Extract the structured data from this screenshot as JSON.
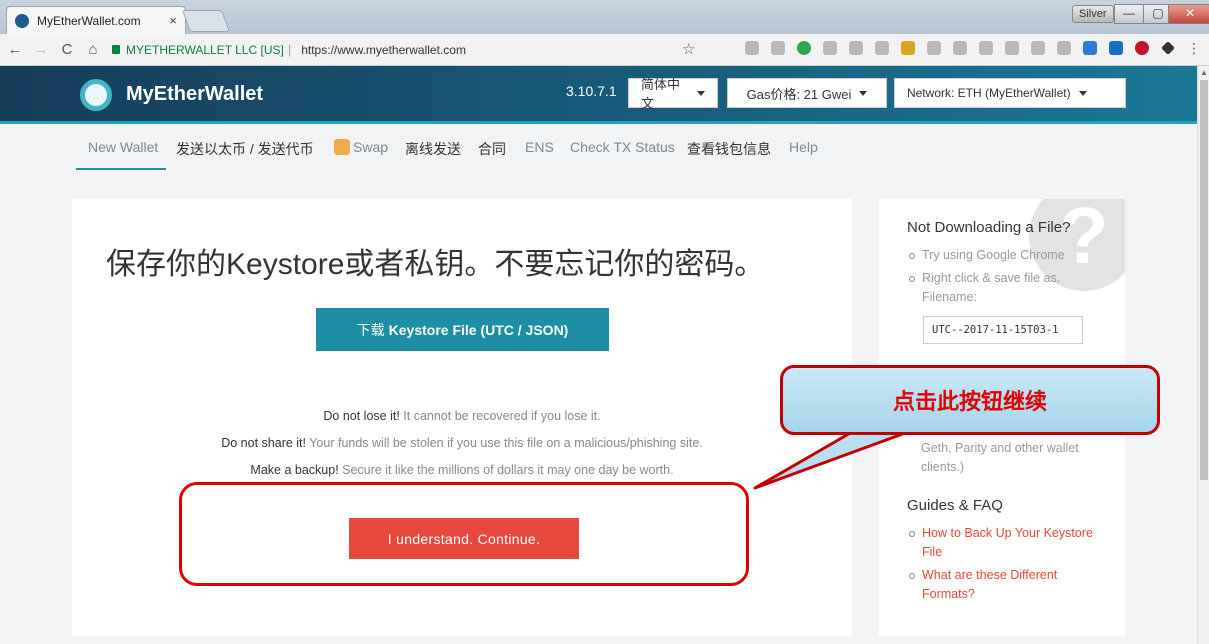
{
  "browser": {
    "tab_title": "MyEtherWallet.com",
    "tab_close": "×",
    "profile": "Silver",
    "win_min": "—",
    "win_max": "▢",
    "win_close": "✕",
    "back": "←",
    "forward": "→",
    "reload": "C",
    "home": "⌂",
    "secure_label": "MYETHERWALLET LLC [US]",
    "url": "https://www.myetherwallet.com",
    "star": "☆"
  },
  "header": {
    "brand": "MyEtherWallet",
    "version": "3.10.7.1",
    "language": "简体中文",
    "gas": "Gas价格: 21 Gwei",
    "network": "Network: ETH (MyEtherWallet)"
  },
  "nav": {
    "new_wallet": "New Wallet",
    "send": "发送以太币 / 发送代币",
    "swap": "Swap",
    "offline": "离线发送",
    "contracts": "合同",
    "ens": "ENS",
    "check_tx": "Check TX Status",
    "view_wallet": "查看钱包信息",
    "help": "Help"
  },
  "main": {
    "heading": "保存你的Keystore或者私钥。不要忘记你的密码。",
    "download_prefix": "下载",
    "download_bold": "Keystore File (UTC / JSON)",
    "warn1_bold": "Do not lose it!",
    "warn1_text": " It cannot be recovered if you lose it.",
    "warn2_bold": "Do not share it!",
    "warn2_text": " Your funds will be stolen if you use this file on a malicious/phishing site.",
    "warn3_bold": "Make a backup!",
    "warn3_text": " Secure it like the millions of dollars it may one day be worth.",
    "continue_button": "I understand. Continue."
  },
  "sidebar": {
    "qmark": "?",
    "title1": "Not Downloading a File?",
    "tips": [
      "Try using Google Chrome",
      "Right click & save file as. Filename:"
    ],
    "filename": "UTC--2017-11-15T03-1",
    "fragment": "Geth, Parity and other wallet clients.)",
    "title2": "Guides & FAQ",
    "guides": [
      "How to Back Up Your Keystore File",
      "What are these Different Formats?"
    ]
  },
  "annotation": {
    "callout_text": "点击此按钮继续"
  },
  "colors": {
    "accent": "#1d8ea4",
    "danger": "#e5483c",
    "header_dark": "#163d5a",
    "annotation_red": "#e00000"
  }
}
